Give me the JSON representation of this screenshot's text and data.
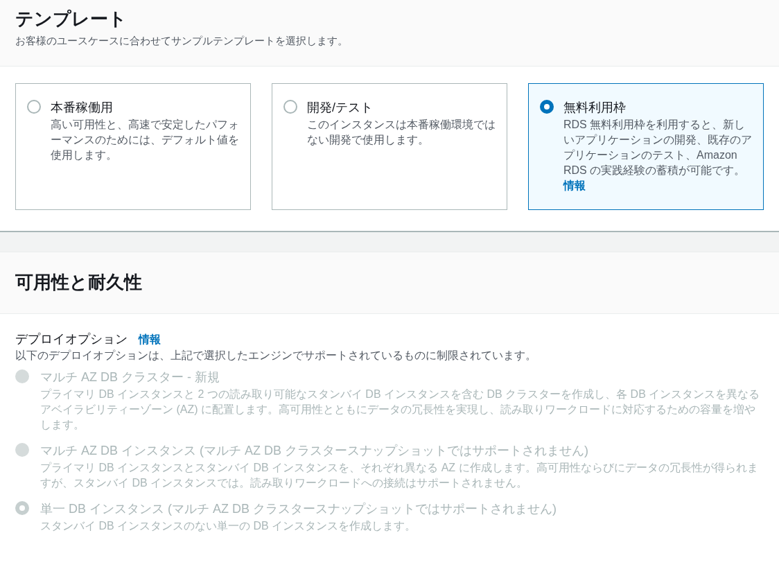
{
  "template_section": {
    "title": "テンプレート",
    "description": "お客様のユースケースに合わせてサンプルテンプレートを選択します。",
    "options": [
      {
        "label": "本番稼働用",
        "description": "高い可用性と、高速で安定したパフォーマンスのためには、デフォルト値を使用します。",
        "selected": false
      },
      {
        "label": "開発/テスト",
        "description": "このインスタンスは本番稼働環境ではない開発で使用します。",
        "selected": false
      },
      {
        "label": "無料利用枠",
        "description": "RDS 無料利用枠を利用すると、新しいアプリケーションの開発、既存のアプリケーションのテスト、Amazon RDS の実践経験の蓄積が可能です。",
        "info_link": "情報",
        "selected": true
      }
    ]
  },
  "availability_section": {
    "title": "可用性と耐久性",
    "deployment": {
      "label": "デプロイオプション",
      "info_link": "情報",
      "description": "以下のデプロイオプションは、上記で選択したエンジンでサポートされているものに制限されています。",
      "options": [
        {
          "label": "マルチ AZ DB クラスター - 新規",
          "description": "プライマリ DB インスタンスと 2 つの読み取り可能なスタンバイ DB インスタンスを含む DB クラスターを作成し、各 DB インスタンスを異なるアベイラビリティーゾーン (AZ) に配置します。高可用性とともにデータの冗長性を実現し、読み取りワークロードに対応するための容量を増やします。",
          "selected": false,
          "disabled": true
        },
        {
          "label": "マルチ AZ DB インスタンス (マルチ AZ DB クラスタースナップショットではサポートされません)",
          "description": "プライマリ DB インスタンスとスタンバイ DB インスタンスを、それぞれ異なる AZ に作成します。高可用性ならびにデータの冗長性が得られますが、スタンバイ DB インスタンスでは。読み取りワークロードへの接続はサポートされません。",
          "selected": false,
          "disabled": true
        },
        {
          "label": "単一 DB インスタンス (マルチ AZ DB クラスタースナップショットではサポートされません)",
          "description": "スタンバイ DB インスタンスのない単一の DB インスタンスを作成します。",
          "selected": true,
          "disabled": true
        }
      ]
    }
  }
}
